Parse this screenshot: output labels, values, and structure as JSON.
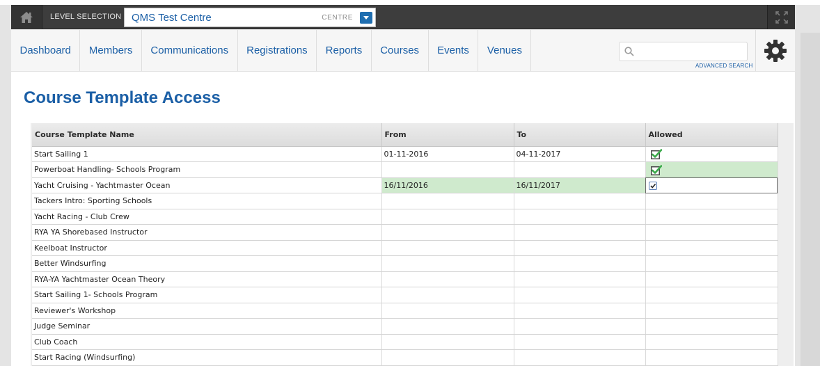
{
  "topbar": {
    "level_label": "LEVEL SELECTION",
    "centre_name": "QMS Test Centre",
    "centre_type": "CENTRE"
  },
  "nav": {
    "tabs": [
      {
        "label": "Dashboard"
      },
      {
        "label": "Members"
      },
      {
        "label": "Communications"
      },
      {
        "label": "Registrations"
      },
      {
        "label": "Reports"
      },
      {
        "label": "Courses"
      },
      {
        "label": "Events"
      },
      {
        "label": "Venues"
      }
    ],
    "search_placeholder": "",
    "advanced_search": "ADVANCED SEARCH"
  },
  "page": {
    "title": "Course Template Access"
  },
  "table": {
    "headers": [
      "Course Template Name",
      "From",
      "To",
      "Allowed"
    ],
    "rows": [
      {
        "name": "Start Sailing 1",
        "from": "01-11-2016",
        "to": "04-11-2017",
        "allowed": "check"
      },
      {
        "name": "Powerboat Handling- Schools Program",
        "from": "",
        "to": "",
        "allowed": "check"
      },
      {
        "name": "Yacht Cruising - Yachtmaster Ocean",
        "from": "16/11/2016",
        "to": "16/11/2017",
        "allowed": "editing"
      },
      {
        "name": "Tackers Intro: Sporting Schools",
        "from": "",
        "to": "",
        "allowed": ""
      },
      {
        "name": "Yacht Racing - Club Crew",
        "from": "",
        "to": "",
        "allowed": ""
      },
      {
        "name": "RYA YA Shorebased Instructor",
        "from": "",
        "to": "",
        "allowed": ""
      },
      {
        "name": "Keelboat Instructor",
        "from": "",
        "to": "",
        "allowed": ""
      },
      {
        "name": "Better Windsurfing",
        "from": "",
        "to": "",
        "allowed": ""
      },
      {
        "name": "RYA-YA Yachtmaster Ocean Theory",
        "from": "",
        "to": "",
        "allowed": ""
      },
      {
        "name": "Start Sailing 1- Schools Program",
        "from": "",
        "to": "",
        "allowed": ""
      },
      {
        "name": "Reviewer's Workshop",
        "from": "",
        "to": "",
        "allowed": ""
      },
      {
        "name": "Judge Seminar",
        "from": "",
        "to": "",
        "allowed": ""
      },
      {
        "name": "Club Coach",
        "from": "",
        "to": "",
        "allowed": ""
      },
      {
        "name": "Start Racing (Windsurfing)",
        "from": "",
        "to": "",
        "allowed": ""
      }
    ]
  },
  "colors": {
    "brand_blue": "#1b5fa6",
    "topbar": "#3d3d3d",
    "highlight_green": "#cfeacd",
    "check_green": "#3aa94a"
  },
  "icons": {
    "home": "home-icon",
    "dropdown": "caret-down-icon",
    "fullscreen": "expand-icon",
    "search": "search-icon",
    "settings": "gear-icon",
    "allowed": "green-check-icon"
  }
}
